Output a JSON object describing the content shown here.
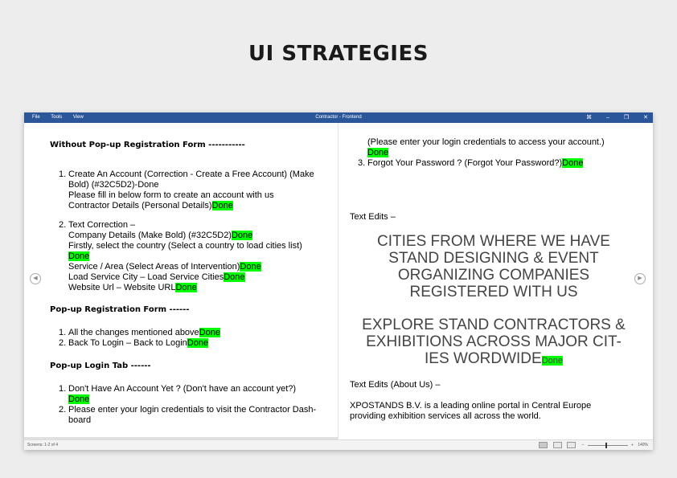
{
  "slide": {
    "title": "UI STRATEGIES"
  },
  "app": {
    "menu": [
      "File",
      "Tools",
      "View"
    ],
    "document_title": "Contractor - Frontend",
    "controls": {
      "fit": "⌘",
      "minimize": "–",
      "restore": "❐",
      "close": "✕"
    }
  },
  "left_page": {
    "section1": {
      "heading": "Without Pop-up Registration Form -----------",
      "item1": {
        "line1": "Create An Account (Correction - Create a Free Account) (Make",
        "line2": "Bold)  (#32C5D2)-Done",
        "line3": "Please fill in below form to create an account with us",
        "line4": "Contractor Details (Personal Details)"
      },
      "item2": {
        "line1": "Text Correction –",
        "line2": "Company Details (Make Bold) (#32C5D2)",
        "line3": "Firstly, select the country (Select a country to load cities list)",
        "line5": "Service / Area (Select Areas of Intervention)",
        "line6": "Load Service City – Load Service Cities",
        "line7": "Website Url – Website URL"
      }
    },
    "section2": {
      "heading": "Pop-up Registration Form ------",
      "item1": "All the changes mentioned above",
      "item2": "Back To Login – Back to Login"
    },
    "section3": {
      "heading": "Pop-up Login Tab ------",
      "item1": "Don't Have An Account Yet ? (Don't have an account yet?)",
      "item2_line1": "Please enter your login credentials to visit the Contractor Dash-",
      "item2_line2": "board"
    }
  },
  "right_page": {
    "cont_line1": "(Please enter your login credentials to access your account.)",
    "item3": "Forgot Your Password ? (Forgot Your Password?)",
    "text_edits_label": "Text Edits –",
    "big1": [
      "CITIES FROM WHERE WE HAVE",
      "STAND DESIGNING & EVENT",
      "ORGANIZING COMPANIES",
      "REGISTERED WITH US"
    ],
    "big2": [
      "EXPLORE STAND CONTRACTORS &",
      "EXHIBITIONS ACROSS MAJOR CIT-",
      "IES WORDWIDE"
    ],
    "about_label": "Text Edits (About Us) –",
    "about_line1": "XPOSTANDS B.V. is a leading online portal in Central Europe",
    "about_line2": "providing exhibition services all across the world."
  },
  "labels": {
    "done": "Done",
    "num1": "1.",
    "num2": "2.",
    "num3": "3."
  },
  "statusbar": {
    "screens": "Screens: 1-2 of 4",
    "zoom": "140%",
    "zoom_minus": "–",
    "zoom_plus": "+"
  },
  "nav": {
    "prev": "◀",
    "next": "▶"
  }
}
